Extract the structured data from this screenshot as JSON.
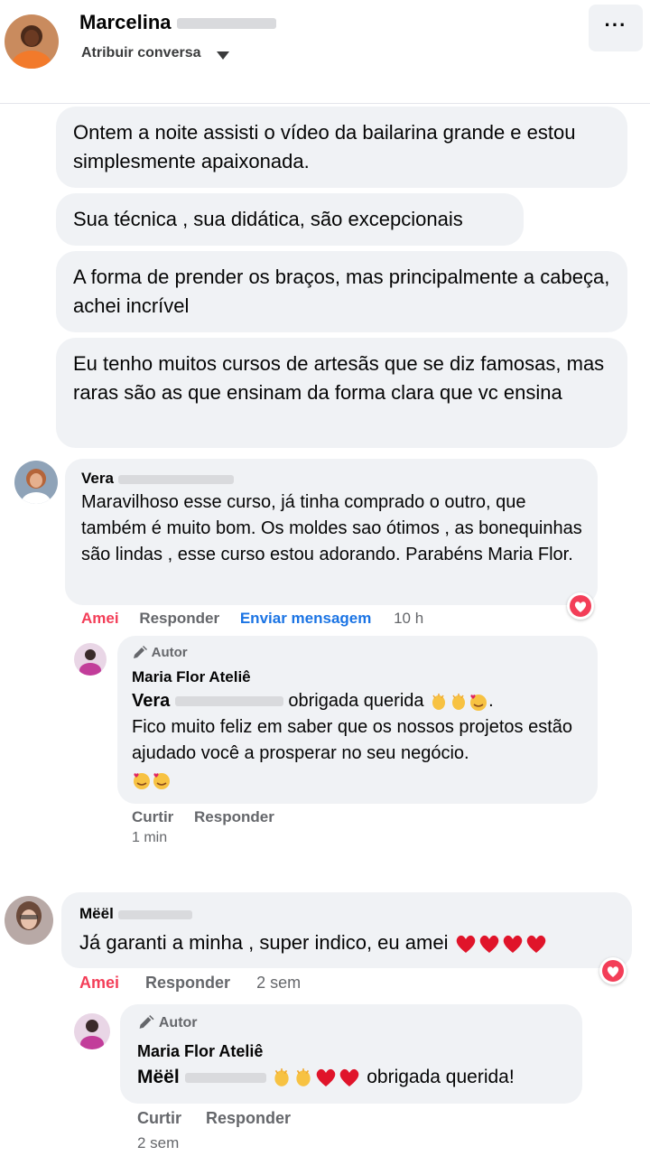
{
  "header": {
    "name_visible": "Marcelina",
    "subtitle": "Atribuir conversa",
    "menu_label": "···"
  },
  "messages": [
    "Ontem a noite assisti o vídeo da bailarina grande e estou simplesmente apaixonada.",
    "Sua técnica , sua didática, são excepcionais",
    "A forma de prender os braços, mas principalmente a cabeça, achei incrível",
    "Eu tenho muitos cursos de artesãs que se diz famosas, mas raras são as que ensinam da forma clara que vc ensina"
  ],
  "comment1": {
    "author_visible": "Vera",
    "text": "Maravilhoso esse curso, já tinha comprado o outro, que também é muito bom. Os moldes sao ótimos , as bonequinhas são lindas , esse curso estou adorando. Parabéns Maria Flor.",
    "like_label": "Amei",
    "reply_label": "Responder",
    "message_label": "Enviar mensagem",
    "time": "10 h",
    "reply": {
      "tag": "Autor",
      "author": "Maria Flor Ateliê",
      "mention": "Vera",
      "text_after_mention": "obrigada querida",
      "line2": "Fico muito feliz em saber que os nossos projetos estão ajudado você a prosperar no seu negócio.",
      "like_label": "Curtir",
      "reply_label": "Responder",
      "time": "1 min"
    }
  },
  "comment2": {
    "author_visible": "Mëël",
    "text": "Já garanti a minha , super indico, eu amei",
    "like_label": "Amei",
    "reply_label": "Responder",
    "time": "2 sem",
    "reply": {
      "tag": "Autor",
      "author": "Maria Flor Ateliê",
      "mention": "Mëël",
      "text_after": "obrigada querida!",
      "like_label": "Curtir",
      "reply_label": "Responder",
      "time": "2 sem"
    }
  },
  "colors": {
    "bubble_bg": "#f0f2f5",
    "love_red": "#f33e58",
    "link_blue": "#1b74e4",
    "meta_gray": "#65676b"
  },
  "icons": [
    "more-horizontal-icon",
    "caret-down-icon",
    "heart-reaction-icon",
    "pencil-icon",
    "clap-emoji",
    "heart-emoji",
    "smiling-hearts-emoji"
  ]
}
